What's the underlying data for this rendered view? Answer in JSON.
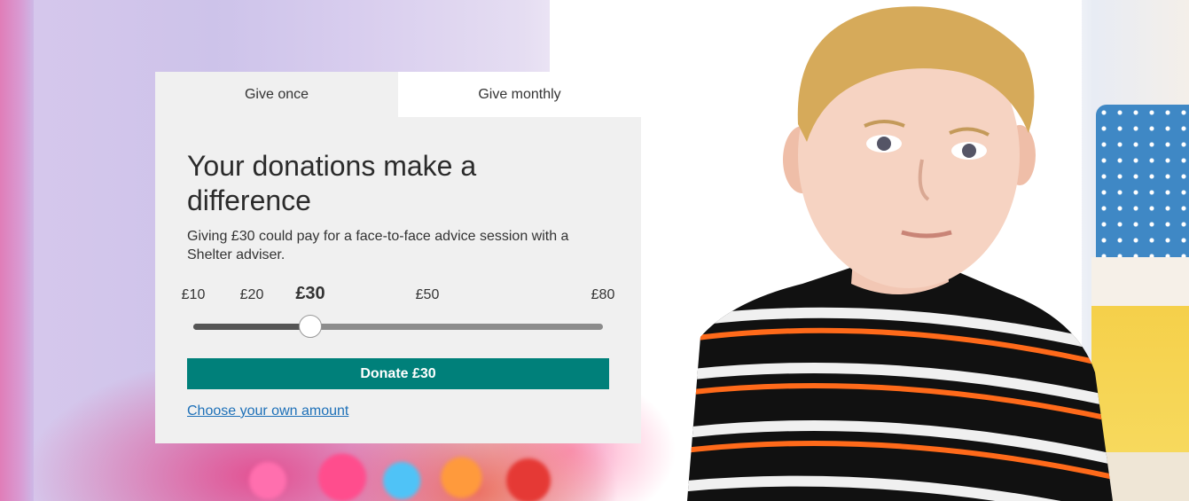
{
  "donation": {
    "tabs": [
      {
        "label": "Give once",
        "active": true
      },
      {
        "label": "Give monthly",
        "active": false
      }
    ],
    "headline": "Your donations make a difference",
    "description": "Giving £30 could pay for a face-to-face advice session with a Shelter adviser.",
    "amounts": [
      {
        "label": "£10",
        "value": 10
      },
      {
        "label": "£20",
        "value": 20
      },
      {
        "label": "£30",
        "value": 30
      },
      {
        "label": "£50",
        "value": 50
      },
      {
        "label": "£80",
        "value": 80
      }
    ],
    "selected_amount": 30,
    "slider": {
      "min": 10,
      "max": 80
    },
    "donate_label": "Donate £30",
    "own_amount_label": "Choose your own amount"
  },
  "colors": {
    "accent_button": "#00807a",
    "link": "#1d70b8",
    "panel_bg": "#f0f0f0"
  }
}
